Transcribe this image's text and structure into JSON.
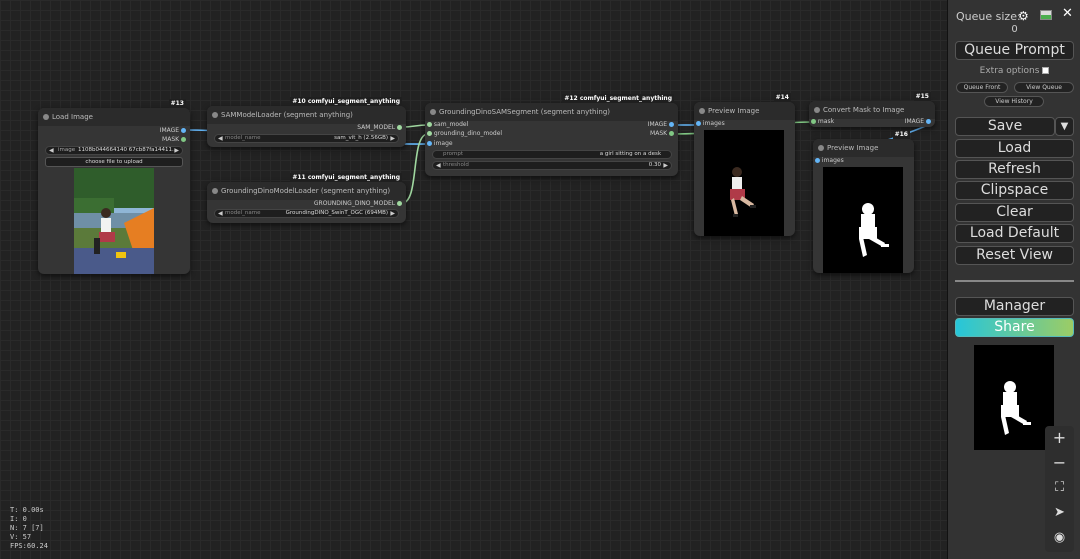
{
  "canvas": {
    "stats": [
      "T: 0.00s",
      "I: 0",
      "N: 7 [7]",
      "V: 57",
      "FPS:60.24"
    ]
  },
  "nodes": {
    "load_image": {
      "badge": "#13",
      "title": "Load Image",
      "outputs": [
        "IMAGE",
        "MASK"
      ],
      "image_label": "image",
      "image_value": "1108b044664140 67cb87fa14411...",
      "upload_label": "choose file to upload"
    },
    "sam_loader": {
      "badge": "#10 comfyui_segment_anything",
      "title": "SAMModelLoader (segment anything)",
      "output": "SAM_MODEL",
      "widget_label": "model_name",
      "widget_value": "sam_vit_h (2.56GB)"
    },
    "dino_loader": {
      "badge": "#11 comfyui_segment_anything",
      "title": "GroundingDinoModelLoader (segment anything)",
      "output": "GROUNDING_DINO_MODEL",
      "widget_label": "model_name",
      "widget_value": "GroundingDINO_SwinT_OGC (694MB)"
    },
    "dino_sam": {
      "badge": "#12 comfyui_segment_anything",
      "title": "GroundingDinoSAMSegment (segment anything)",
      "inputs": [
        "sam_model",
        "grounding_dino_model",
        "image"
      ],
      "outputs": [
        "IMAGE",
        "MASK"
      ],
      "prompt_label": "prompt",
      "prompt_value": "a girl sitting on a desk",
      "threshold_label": "threshold",
      "threshold_value": "0.30"
    },
    "preview1": {
      "badge": "#14",
      "title": "Preview Image",
      "input": "images"
    },
    "convert_mask": {
      "badge": "#15",
      "title": "Convert Mask to Image",
      "input": "mask",
      "output": "IMAGE"
    },
    "preview2": {
      "badge": "#16",
      "title": "Preview Image",
      "input": "images"
    }
  },
  "sidebar": {
    "queue_size_label": "Queue size:",
    "queue_size_value": "0",
    "queue_prompt": "Queue Prompt",
    "extra_options": "Extra options",
    "queue_front": "Queue Front",
    "view_queue": "View Queue",
    "view_history": "View History",
    "save": "Save",
    "load": "Load",
    "refresh": "Refresh",
    "clipspace": "Clipspace",
    "clear": "Clear",
    "load_default": "Load Default",
    "reset_view": "Reset View",
    "manager": "Manager",
    "share": "Share",
    "icons": [
      "gear-icon",
      "image-icon",
      "close-icon"
    ]
  },
  "zoom_controls": [
    "zoom-in-icon",
    "zoom-out-icon",
    "fit-view-icon",
    "locate-icon",
    "eye-icon"
  ],
  "colors": {
    "canvas_bg": "#222222",
    "node_bg": "#353535",
    "image_link": "#64b5f6",
    "mask_link": "#81c784",
    "share_gradient_start": "#26c6da",
    "share_gradient_end": "#9ccc65"
  }
}
